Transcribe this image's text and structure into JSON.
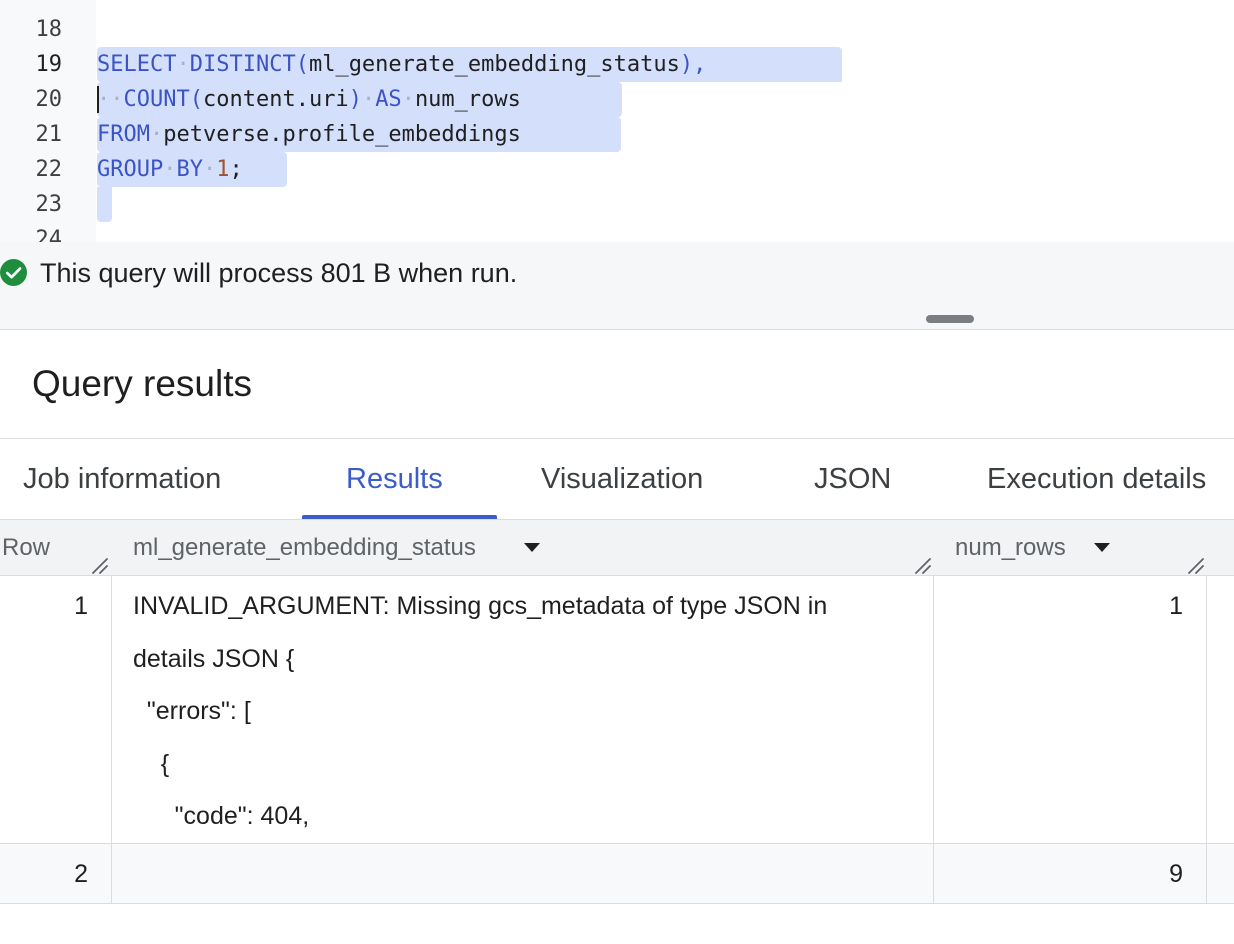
{
  "editor": {
    "lines": [
      {
        "num": "18"
      },
      {
        "num": "19"
      },
      {
        "num": "20"
      },
      {
        "num": "21"
      },
      {
        "num": "22"
      },
      {
        "num": "23"
      },
      {
        "num": "24"
      }
    ],
    "code": {
      "l19_kw1": "SELECT",
      "l19_kw2": "DISTINCT(",
      "l19_id": "ml_generate_embedding_status",
      "l19_tail": "),",
      "l20_kw1": "COUNT(",
      "l20_id": "content.uri",
      "l20_close": ")",
      "l20_kw2": "AS",
      "l20_id2": "num_rows",
      "l21_kw": "FROM",
      "l21_id": "petverse.profile_embeddings",
      "l22_kw1": "GROUP",
      "l22_kw2": "BY",
      "l22_num": "1",
      "l22_tail": ";"
    }
  },
  "status": {
    "icon": "check-circle-icon",
    "text": "This query will process 801 B when run."
  },
  "results": {
    "title": "Query results",
    "tabs": [
      {
        "label": "Job information"
      },
      {
        "label": "Results",
        "active": true
      },
      {
        "label": "Visualization"
      },
      {
        "label": "JSON"
      },
      {
        "label": "Execution details"
      }
    ],
    "columns": {
      "row": "Row",
      "status": "ml_generate_embedding_status",
      "num_rows": "num_rows"
    },
    "rows": [
      {
        "row": "1",
        "status_lines": [
          "INVALID_ARGUMENT: Missing gcs_metadata of type JSON in",
          "details JSON {",
          "  \"errors\": [",
          "    {",
          "      \"code\": 404,"
        ],
        "num_rows": "1"
      },
      {
        "row": "2",
        "status_lines": [],
        "num_rows": "9"
      }
    ]
  },
  "colors": {
    "accent": "#3b5cc9",
    "selection": "#d4e0fb",
    "success": "#1e8e3e"
  }
}
